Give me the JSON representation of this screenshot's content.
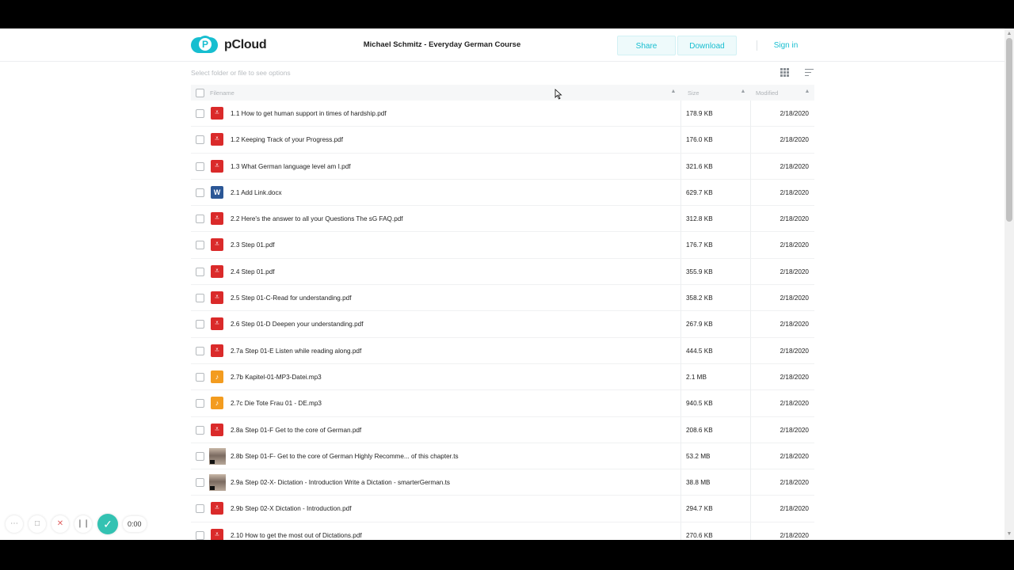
{
  "header": {
    "logo_text": "pCloud",
    "title": "Michael Schmitz - Everyday German Course",
    "share_label": "Share",
    "download_label": "Download",
    "signin_label": "Sign in"
  },
  "toolbar": {
    "hint": "Select folder or file to see options",
    "grid_view_icon": "grid-icon",
    "sort_icon": "sort-icon"
  },
  "table": {
    "columns": {
      "name": "Filename",
      "size": "Size",
      "modified": "Modified"
    },
    "rows": [
      {
        "type": "pdf",
        "name": "1.1 How to get human support in times of hardship.pdf",
        "size": "178.9 KB",
        "modified": "2/18/2020"
      },
      {
        "type": "pdf",
        "name": "1.2 Keeping Track of your Progress.pdf",
        "size": "176.0 KB",
        "modified": "2/18/2020"
      },
      {
        "type": "pdf",
        "name": "1.3 What German language level am I.pdf",
        "size": "321.6 KB",
        "modified": "2/18/2020"
      },
      {
        "type": "doc",
        "name": "2.1 Add Link.docx",
        "size": "629.7 KB",
        "modified": "2/18/2020"
      },
      {
        "type": "pdf",
        "name": "2.2 Here's the answer to all your Questions The sG FAQ.pdf",
        "size": "312.8 KB",
        "modified": "2/18/2020"
      },
      {
        "type": "pdf",
        "name": "2.3 Step 01.pdf",
        "size": "176.7 KB",
        "modified": "2/18/2020"
      },
      {
        "type": "pdf",
        "name": "2.4 Step 01.pdf",
        "size": "355.9 KB",
        "modified": "2/18/2020"
      },
      {
        "type": "pdf",
        "name": "2.5 Step 01-C-Read for understanding.pdf",
        "size": "358.2 KB",
        "modified": "2/18/2020"
      },
      {
        "type": "pdf",
        "name": "2.6 Step 01-D Deepen your understanding.pdf",
        "size": "267.9 KB",
        "modified": "2/18/2020"
      },
      {
        "type": "pdf",
        "name": "2.7a Step 01-E Listen while reading along.pdf",
        "size": "444.5 KB",
        "modified": "2/18/2020"
      },
      {
        "type": "mp3",
        "name": "2.7b Kapitel-01-MP3-Datei.mp3",
        "size": "2.1 MB",
        "modified": "2/18/2020"
      },
      {
        "type": "mp3",
        "name": "2.7c Die Tote Frau 01 - DE.mp3",
        "size": "940.5 KB",
        "modified": "2/18/2020"
      },
      {
        "type": "pdf",
        "name": "2.8a Step 01-F Get to the core of German.pdf",
        "size": "208.6 KB",
        "modified": "2/18/2020"
      },
      {
        "type": "vid",
        "name": "2.8b Step 01-F- Get to the core of German Highly Recomme... of this chapter.ts",
        "size": "53.2 MB",
        "modified": "2/18/2020"
      },
      {
        "type": "vid",
        "name": "2.9a Step 02-X- Dictation - Introduction Write a Dictation - smarterGerman.ts",
        "size": "38.8 MB",
        "modified": "2/18/2020"
      },
      {
        "type": "pdf",
        "name": "2.9b Step 02-X Dictation - Introduction.pdf",
        "size": "294.7 KB",
        "modified": "2/18/2020"
      },
      {
        "type": "pdf",
        "name": "2.10 How to get the most out of Dictations.pdf",
        "size": "270.6 KB",
        "modified": "2/18/2020"
      }
    ]
  },
  "recorder": {
    "time": "0:00",
    "icons": [
      "more-icon",
      "camera-icon",
      "close-icon",
      "pause-icon",
      "check-icon"
    ]
  },
  "colors": {
    "accent": "#17bed0",
    "pdf": "#da2a2a",
    "doc": "#2b5796",
    "mp3": "#f39c1f",
    "recorder_ok": "#33c2b2"
  }
}
